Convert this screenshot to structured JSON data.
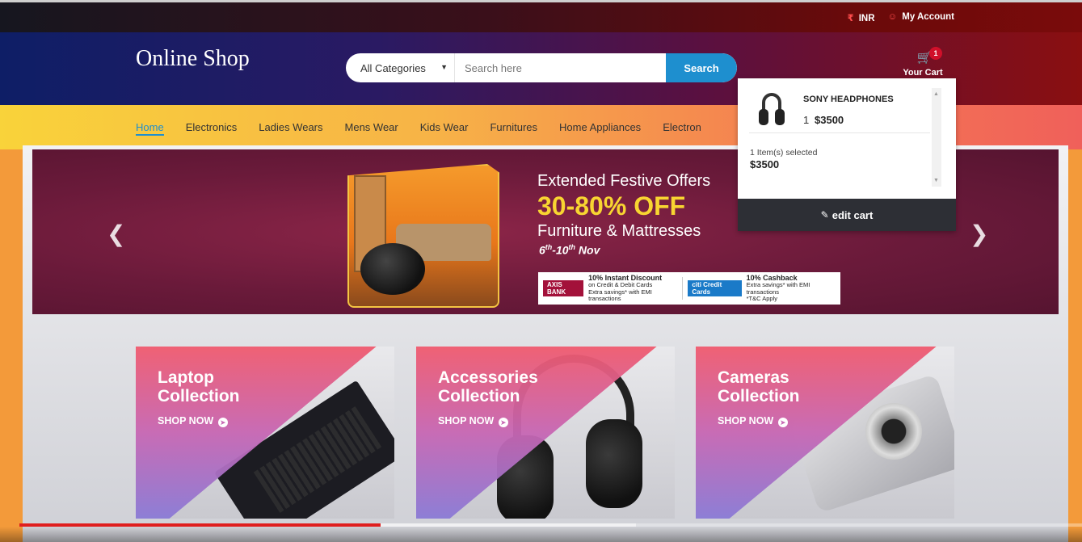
{
  "top_bar": {
    "currency": "INR",
    "account": "My Account"
  },
  "header": {
    "logo": "Online Shop",
    "search": {
      "category": "All Categories",
      "placeholder": "Search here",
      "button": "Search"
    },
    "cart": {
      "count": "1",
      "label": "Your Cart"
    }
  },
  "nav": {
    "items": [
      "Home",
      "Electronics",
      "Ladies Wears",
      "Mens Wear",
      "Kids Wear",
      "Furnitures",
      "Home Appliances",
      "Electron"
    ],
    "active": "Home"
  },
  "banner": {
    "title": "Extended Festive Offers",
    "discount": "30-80% OFF",
    "subtitle": "Furniture & Mattresses",
    "dates": "6th-10th Nov",
    "offers": [
      {
        "bank": "AXIS BANK",
        "headline": "10% Instant Discount",
        "detail": "on Credit & Debit Cards",
        "extra": "Extra savings* with EMI transactions"
      },
      {
        "bank": "citi Credit Cards",
        "headline": "10% Cashback",
        "detail": "Extra savings* with EMI transactions",
        "extra": "*T&C Apply"
      }
    ]
  },
  "cart_dropdown": {
    "item_name": "SONY HEADPHONES",
    "item_qty": "1",
    "item_price": "$3500",
    "summary": "1 Item(s) selected",
    "total": "$3500",
    "edit_label": "edit cart"
  },
  "collections": [
    {
      "title_line1": "Laptop",
      "title_line2": "Collection",
      "cta": "SHOP NOW"
    },
    {
      "title_line1": "Accessories",
      "title_line2": "Collection",
      "cta": "SHOP NOW"
    },
    {
      "title_line1": "Cameras",
      "title_line2": "Collection",
      "cta": "SHOP NOW"
    }
  ],
  "video": {
    "played_fraction": 0.34,
    "buffered_fraction": 0.58
  }
}
